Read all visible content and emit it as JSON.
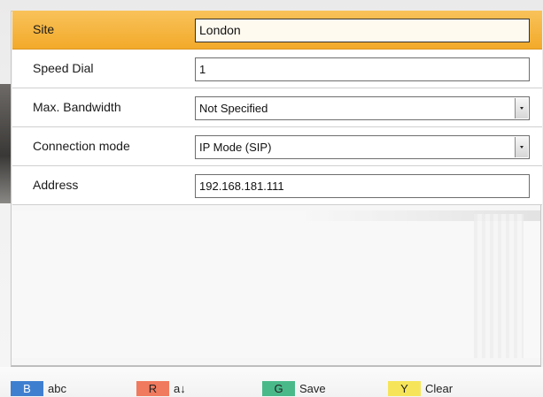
{
  "form": {
    "rows": [
      {
        "label": "Site",
        "value": "London",
        "type": "text",
        "active": true
      },
      {
        "label": "Speed Dial",
        "value": "1",
        "type": "text"
      },
      {
        "label": "Max. Bandwidth",
        "value": "Not Specified",
        "type": "select"
      },
      {
        "label": "Connection mode",
        "value": "IP Mode (SIP)",
        "type": "select"
      },
      {
        "label": "Address",
        "value": "192.168.181.111",
        "type": "text"
      }
    ]
  },
  "footer": {
    "keys": [
      {
        "cap": "B",
        "label": "abc",
        "color": "#3f7fd0"
      },
      {
        "cap": "R",
        "label": "a↓",
        "color": "#f07a5e"
      },
      {
        "cap": "G",
        "label": "Save",
        "color": "#49b98a"
      },
      {
        "cap": "Y",
        "label": "Clear",
        "color": "#f6e55a"
      }
    ]
  },
  "colors": {
    "highlight": "#f3aa2a"
  }
}
